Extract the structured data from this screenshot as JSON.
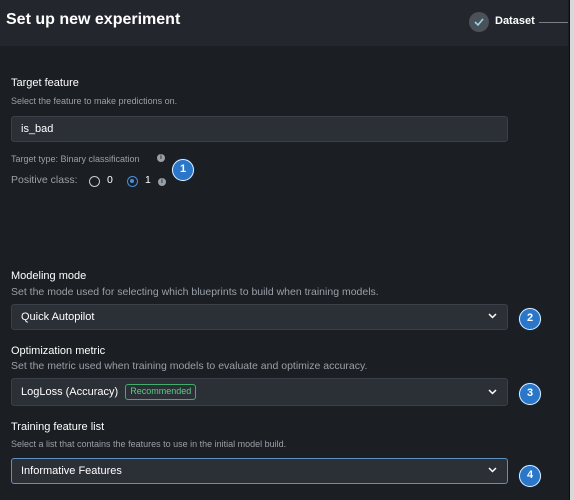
{
  "header": {
    "title": "Set up new experiment",
    "step_label": "Dataset"
  },
  "target": {
    "label": "Target feature",
    "help": "Select the feature to make predictions on.",
    "value": "is_bad",
    "type_text": "Target type: Binary classification",
    "positive_class_label": "Positive class:",
    "options": [
      "0",
      "1"
    ],
    "selected_option": "1"
  },
  "modeling": {
    "label": "Modeling mode",
    "help": "Set the mode used for selecting which blueprints to build when training models.",
    "value": "Quick Autopilot"
  },
  "metric": {
    "label": "Optimization metric",
    "help": "Set the metric used when training models to evaluate and optimize accuracy.",
    "value": "LogLoss (Accuracy)",
    "badge": "Recommended"
  },
  "featurelist": {
    "label": "Training feature list",
    "help": "Select a list that contains the features to use in the initial model build.",
    "value": "Informative Features"
  },
  "callouts": [
    "1",
    "2",
    "3",
    "4"
  ],
  "colors": {
    "accent": "#2a76c9",
    "recommended": "#5ccd86",
    "background": "#1b1e23"
  }
}
